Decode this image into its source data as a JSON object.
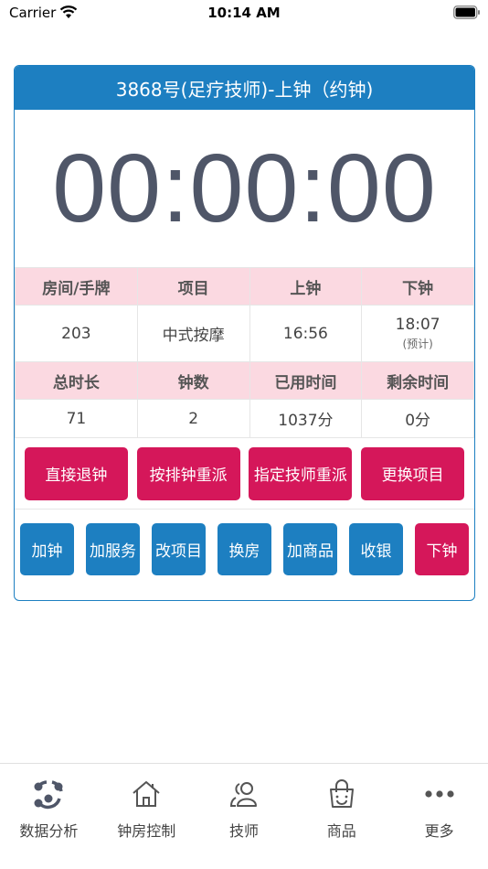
{
  "status_bar": {
    "carrier": "Carrier",
    "time": "10:14 AM"
  },
  "card": {
    "title": "3868号(足疗技师)-上钟（约钟)",
    "timer": "00:00:00",
    "table": {
      "headers_1": [
        "房间/手牌",
        "项目",
        "上钟",
        "下钟"
      ],
      "values_1": [
        "203",
        "中式按摩",
        "16:56",
        "18:07"
      ],
      "end_note": "(预计)",
      "headers_2": [
        "总时长",
        "钟数",
        "已用时间",
        "剩余时间"
      ],
      "values_2": [
        "71",
        "2",
        "1037分",
        "0分"
      ]
    },
    "actions": [
      "直接退钟",
      "按排钟重派",
      "指定技师重派",
      "更换项目"
    ],
    "operations": [
      "加钟",
      "加服务",
      "改项目",
      "换房",
      "加商品",
      "收银",
      "下钟"
    ]
  },
  "tabs": [
    {
      "label": "数据分析",
      "icon": "analytics-icon"
    },
    {
      "label": "钟房控制",
      "icon": "home-icon"
    },
    {
      "label": "技师",
      "icon": "users-icon"
    },
    {
      "label": "商品",
      "icon": "shopping-bag-icon"
    },
    {
      "label": "更多",
      "icon": "more-icon"
    }
  ],
  "colors": {
    "primary": "#1d7fc1",
    "accent": "#d5175a",
    "header_row": "#fbd9e1",
    "timer": "#4f5668"
  }
}
